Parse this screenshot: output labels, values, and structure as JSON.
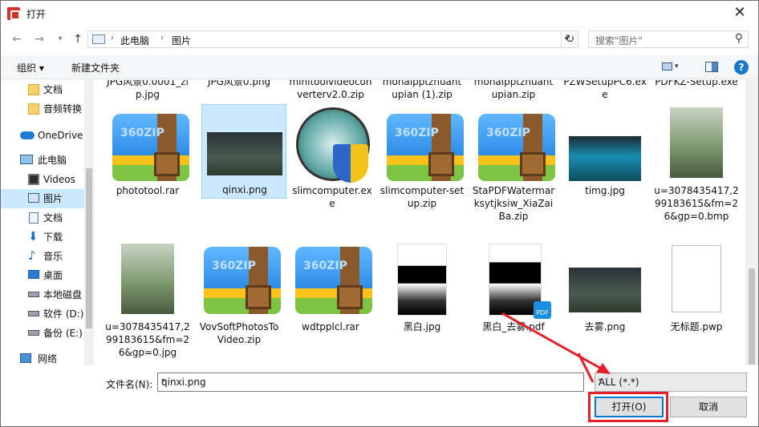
{
  "window": {
    "title": "打开"
  },
  "address": {
    "crumbs": [
      "此电脑",
      "图片"
    ],
    "refresh_label": "↻"
  },
  "search": {
    "placeholder": "搜索\"图片\""
  },
  "toolbar": {
    "organize": "组织 ▾",
    "new_folder": "新建文件夹",
    "help": "?"
  },
  "sidebar": {
    "items": [
      {
        "label": "文档",
        "icon": "folder-icon"
      },
      {
        "label": "音频转换",
        "icon": "folder-icon"
      },
      {
        "label": "OneDrive",
        "icon": "cloud-icon"
      },
      {
        "label": "此电脑",
        "icon": "computer-icon"
      },
      {
        "label": "Videos",
        "icon": "video-icon"
      },
      {
        "label": "图片",
        "icon": "pictures-icon",
        "selected": true
      },
      {
        "label": "文档",
        "icon": "document-icon"
      },
      {
        "label": "下载",
        "icon": "download-icon"
      },
      {
        "label": "音乐",
        "icon": "music-icon"
      },
      {
        "label": "桌面",
        "icon": "desktop-icon"
      },
      {
        "label": "本地磁盘",
        "icon": "disk-icon"
      },
      {
        "label": "软件 (D:)",
        "icon": "disk-icon"
      },
      {
        "label": "备份 (E:)",
        "icon": "disk-icon"
      },
      {
        "label": "网络",
        "icon": "network-icon"
      }
    ]
  },
  "files_row0": [
    "JPG风景0.0001_zip.jpg",
    "JPG风景0.png",
    "minitoolvideoconverterv2.0.zip",
    "mohaipptzhuantupian (1).zip",
    "mohaipptzhuantupian.zip",
    "PZWSetupPC6.exe",
    "PDFKZ-Setup.exe"
  ],
  "files_row1": [
    "phototool.rar",
    "qinxi.png",
    "slimcomputer.exe",
    "slimcomputer-setup.zip",
    "StaPDFWatermarksytjksiw_XiaZaiBa.zip",
    "timg.jpg",
    "u=3078435417,299183615&fm=26&gp=0.bmp"
  ],
  "files_row2": [
    "u=3078435417,299183615&fm=26&gp=0.jpg",
    "VovSoftPhotosToVideo.zip",
    "wdtpplcl.rar",
    "黑白.jpg",
    "黑白_去雾.pdf",
    "去雾.png",
    "无标题.pwp"
  ],
  "zip_text": "360ZIP",
  "bottom": {
    "filename_label": "文件名(N):",
    "filename_value": "qinxi.png",
    "filetype_value": "ALL (*.*)",
    "open_label": "打开(O)",
    "cancel_label": "取消"
  },
  "colors": {
    "accent": "#0078d7",
    "highlight": "#e3202a",
    "selection": "#cce8ff"
  }
}
